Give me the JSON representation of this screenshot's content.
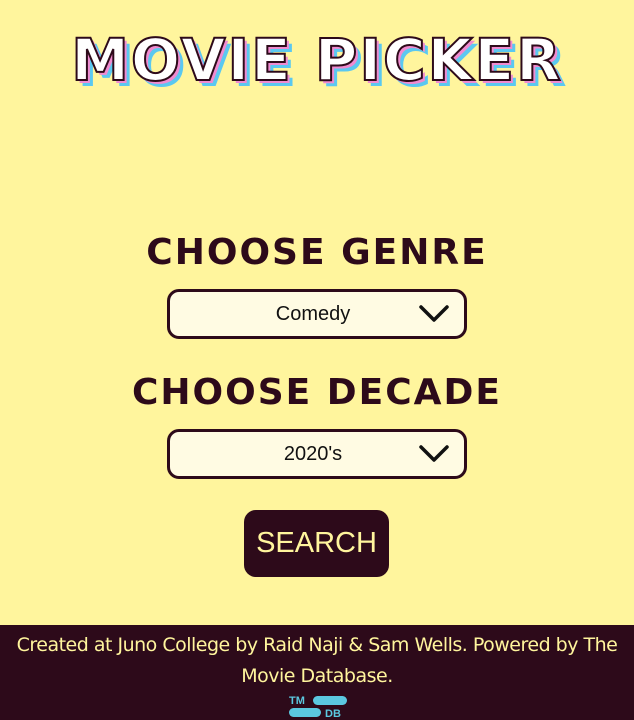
{
  "header": {
    "title": "MOVIE PICKER"
  },
  "genre": {
    "heading": "CHOOSE GENRE",
    "selected": "Comedy"
  },
  "decade": {
    "heading": "CHOOSE DECADE",
    "selected": "2020's"
  },
  "search": {
    "label": "SEARCH"
  },
  "footer": {
    "credit": "Created at Juno College by Raid Naji & Sam Wells. Powered by The Movie Database.",
    "logo_top": "TM",
    "logo_bottom": "DB",
    "logo_icon": "tmdb-logo"
  },
  "colors": {
    "background": "#fff59d",
    "accent_dark": "#2d0a1a",
    "select_fill": "#fffbe3",
    "title_shadow_pink": "#f08bd0",
    "title_shadow_blue": "#5bc8f0",
    "tmdb_teal": "#5bc8e0"
  }
}
